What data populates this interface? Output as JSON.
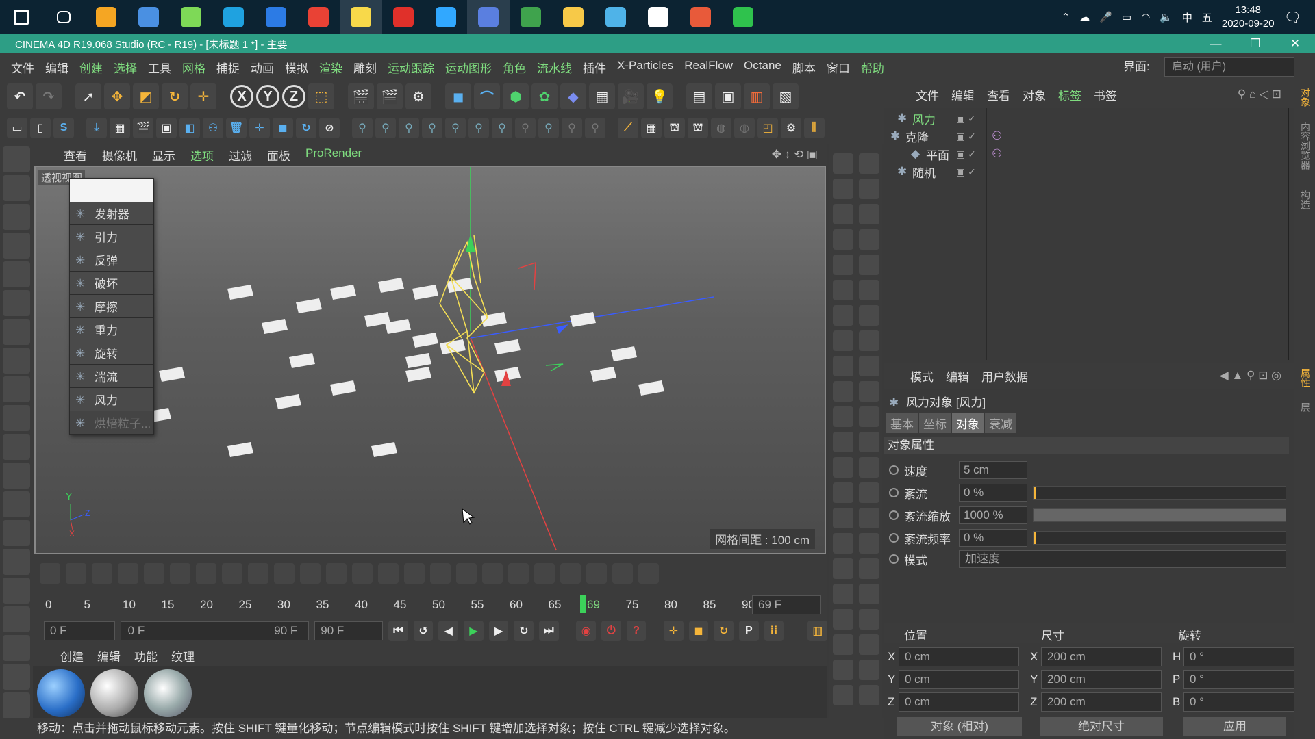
{
  "taskbar": {
    "apps": [
      {
        "name": "start-icon",
        "color": "#ffffff"
      },
      {
        "name": "task-view-icon",
        "color": "#ffffff"
      },
      {
        "name": "app-icon-1",
        "color": "#f5a623"
      },
      {
        "name": "app-icon-2",
        "color": "#4a90e2"
      },
      {
        "name": "app-icon-3",
        "color": "#7ed957"
      },
      {
        "name": "edge-icon",
        "color": "#1fa2e0"
      },
      {
        "name": "browser-icon",
        "color": "#2c7be5"
      },
      {
        "name": "chrome-icon",
        "color": "#e94235"
      },
      {
        "name": "app-icon-4",
        "color": "#f8d94a"
      },
      {
        "name": "youdao-icon",
        "color": "#e0302a"
      },
      {
        "name": "photoshop-icon",
        "color": "#31a8ff"
      },
      {
        "name": "cinema4d-icon",
        "color": "#5a7fe0"
      },
      {
        "name": "app-icon-5",
        "color": "#3fa34d"
      },
      {
        "name": "explorer-icon",
        "color": "#f7c948"
      },
      {
        "name": "app-icon-6",
        "color": "#4fb3e8"
      },
      {
        "name": "app-icon-7",
        "color": "#ffffff"
      },
      {
        "name": "app-icon-8",
        "color": "#e85a3a"
      },
      {
        "name": "wechat-icon",
        "color": "#2fc24d"
      }
    ],
    "tray": {
      "ime1": "中",
      "ime2": "五",
      "time": "13:48",
      "date": "2020-09-20"
    }
  },
  "title": "CINEMA 4D R19.068 Studio (RC - R19) - [未标题 1 *] - 主要",
  "menu": {
    "items": [
      {
        "label": "文件",
        "hl": false
      },
      {
        "label": "编辑",
        "hl": false
      },
      {
        "label": "创建",
        "hl": true
      },
      {
        "label": "选择",
        "hl": true
      },
      {
        "label": "工具",
        "hl": false
      },
      {
        "label": "网格",
        "hl": true
      },
      {
        "label": "捕捉",
        "hl": false
      },
      {
        "label": "动画",
        "hl": false
      },
      {
        "label": "模拟",
        "hl": false
      },
      {
        "label": "渲染",
        "hl": true
      },
      {
        "label": "雕刻",
        "hl": false
      },
      {
        "label": "运动跟踪",
        "hl": true
      },
      {
        "label": "运动图形",
        "hl": true
      },
      {
        "label": "角色",
        "hl": true
      },
      {
        "label": "流水线",
        "hl": true
      },
      {
        "label": "插件",
        "hl": false
      },
      {
        "label": "X-Particles",
        "hl": false
      },
      {
        "label": "RealFlow",
        "hl": false
      },
      {
        "label": "Octane",
        "hl": false
      },
      {
        "label": "脚本",
        "hl": false
      },
      {
        "label": "窗口",
        "hl": false
      },
      {
        "label": "帮助",
        "hl": true
      }
    ],
    "layout_label": "界面:",
    "layout_value": "启动 (用户)"
  },
  "viewport": {
    "menu": [
      {
        "label": "查看",
        "hl": false
      },
      {
        "label": "摄像机",
        "hl": false
      },
      {
        "label": "显示",
        "hl": false
      },
      {
        "label": "选项",
        "hl": true
      },
      {
        "label": "过滤",
        "hl": false
      },
      {
        "label": "面板",
        "hl": false
      },
      {
        "label": "ProRender",
        "hl": true
      }
    ],
    "label": "透视视图",
    "grid": "网格间距 : 100 cm"
  },
  "dropdown": {
    "items": [
      {
        "label": "发射器",
        "enabled": true
      },
      {
        "label": "引力",
        "enabled": true
      },
      {
        "label": "反弹",
        "enabled": true
      },
      {
        "label": "破坏",
        "enabled": true
      },
      {
        "label": "摩擦",
        "enabled": true
      },
      {
        "label": "重力",
        "enabled": true
      },
      {
        "label": "旋转",
        "enabled": true
      },
      {
        "label": "湍流",
        "enabled": true
      },
      {
        "label": "风力",
        "enabled": true
      },
      {
        "label": "烘焙粒子...",
        "enabled": false
      }
    ]
  },
  "timeline": {
    "ticks": [
      "0",
      "5",
      "10",
      "15",
      "20",
      "25",
      "30",
      "35",
      "40",
      "45",
      "50",
      "55",
      "60",
      "65",
      "69",
      "75",
      "80",
      "85",
      "90"
    ],
    "current": "69",
    "frame_readout": "69 F",
    "start": "0 F",
    "range_start": "0 F",
    "range_end": "90 F",
    "end": "90 F"
  },
  "materials": {
    "menu": [
      "创建",
      "编辑",
      "功能",
      "纹理"
    ]
  },
  "status": "移动：点击并拖动鼠标移动元素。按住 SHIFT 键量化移动；节点编辑模式时按住 SHIFT 键增加选择对象；按住 CTRL 键减少选择对象。",
  "objects": {
    "menu": [
      {
        "label": "文件",
        "hl": false
      },
      {
        "label": "编辑",
        "hl": false
      },
      {
        "label": "查看",
        "hl": false
      },
      {
        "label": "对象",
        "hl": false
      },
      {
        "label": "标签",
        "hl": true
      },
      {
        "label": "书签",
        "hl": false
      }
    ],
    "rows": [
      {
        "name": "风力",
        "selected": true
      },
      {
        "name": "克隆",
        "selected": false
      },
      {
        "name": "平面",
        "selected": false
      },
      {
        "name": "随机",
        "selected": false
      }
    ]
  },
  "attributes": {
    "menu": [
      "模式",
      "编辑",
      "用户数据"
    ],
    "title": "风力对象 [风力]",
    "tabs": [
      {
        "label": "基本",
        "on": false
      },
      {
        "label": "坐标",
        "on": false
      },
      {
        "label": "对象",
        "on": true
      },
      {
        "label": "衰减",
        "on": false
      }
    ],
    "section": "对象属性",
    "props": [
      {
        "label": "速度",
        "value": "5 cm",
        "level": null
      },
      {
        "label": "紊流",
        "value": "0 %",
        "level": 0
      },
      {
        "label": "紊流缩放",
        "value": "1000 %",
        "level": 1
      },
      {
        "label": "紊流频率",
        "value": "0 %",
        "level": 0
      }
    ],
    "mode_label": "模式",
    "mode_value": "加速度"
  },
  "coords": {
    "heads": [
      "位置",
      "尺寸",
      "旋转"
    ],
    "pos": [
      {
        "axis": "X",
        "value": "0 cm"
      },
      {
        "axis": "Y",
        "value": "0 cm"
      },
      {
        "axis": "Z",
        "value": "0 cm"
      }
    ],
    "size": [
      {
        "axis": "X",
        "value": "200 cm"
      },
      {
        "axis": "Y",
        "value": "200 cm"
      },
      {
        "axis": "Z",
        "value": "200 cm"
      }
    ],
    "rot": [
      {
        "axis": "H",
        "value": "0 °"
      },
      {
        "axis": "P",
        "value": "0 °"
      },
      {
        "axis": "B",
        "value": "0 °"
      }
    ],
    "mode1": "对象 (相对)",
    "mode2": "绝对尺寸",
    "apply": "应用"
  }
}
